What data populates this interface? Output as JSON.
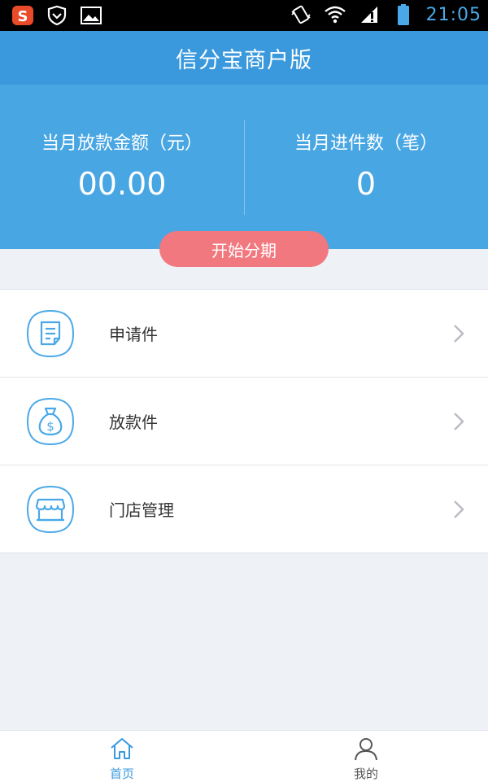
{
  "status_bar": {
    "time": "21:05",
    "icons": [
      "sogou-input-icon",
      "shield-icon",
      "gallery-icon",
      "vibrate-icon",
      "wifi-icon",
      "alert-icon",
      "battery-icon"
    ]
  },
  "header": {
    "title": "信分宝商户版"
  },
  "stats": {
    "monthly_loan_amount": {
      "label": "当月放款金额（元）",
      "value": "00.00"
    },
    "monthly_count": {
      "label": "当月进件数（笔）",
      "value": "0"
    }
  },
  "start_button": {
    "label": "开始分期"
  },
  "menu": {
    "items": [
      {
        "label": "申请件",
        "icon": "application-form-icon"
      },
      {
        "label": "放款件",
        "icon": "money-bag-icon"
      },
      {
        "label": "门店管理",
        "icon": "store-icon"
      }
    ]
  },
  "bottom_nav": {
    "items": [
      {
        "label": "首页",
        "icon": "home-icon",
        "active": true
      },
      {
        "label": "我的",
        "icon": "user-icon",
        "active": false
      }
    ]
  },
  "colors": {
    "title_bar": "#3a99dd",
    "stats_bg": "#48a6e3",
    "accent_pink": "#f2787f",
    "icon_blue": "#4aa8e8"
  }
}
